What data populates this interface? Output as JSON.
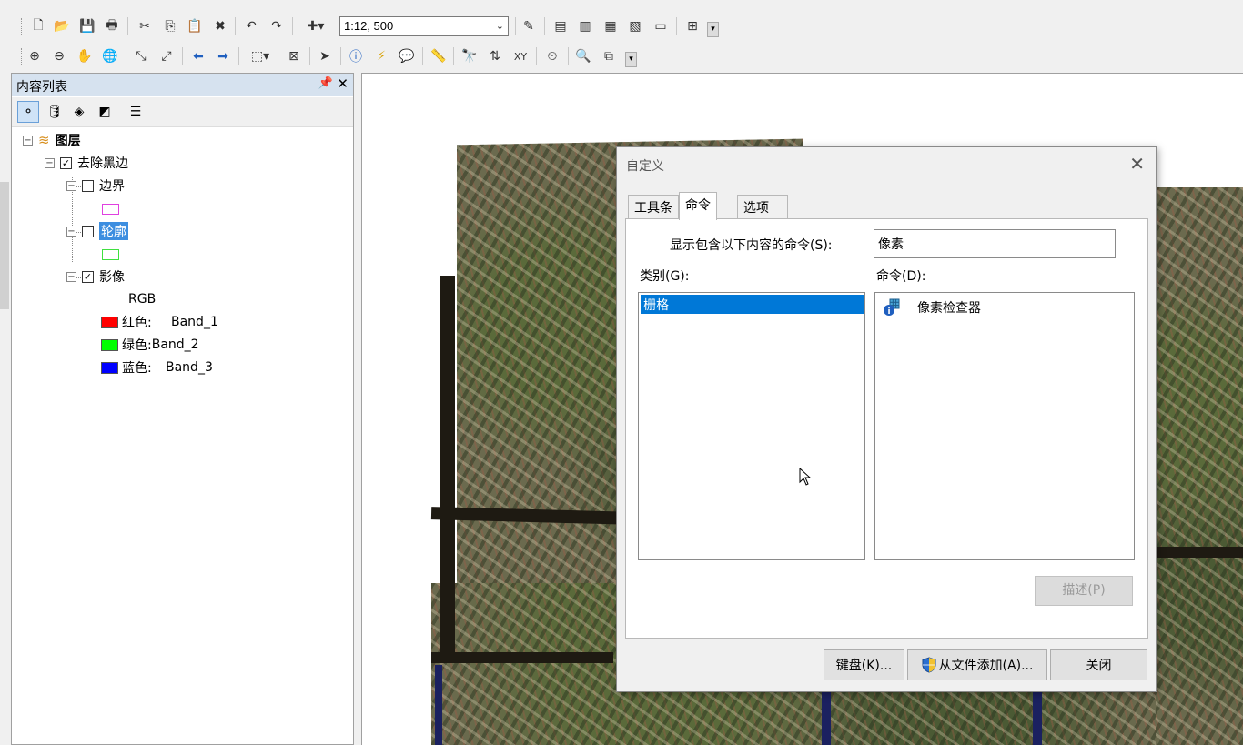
{
  "toolbar": {
    "scale_value": "1:12, 500"
  },
  "toc": {
    "title": "内容列表",
    "pin_icon": "pin-icon",
    "close_glyph": "✕",
    "tree": {
      "root_label": "图层",
      "group_label": "去除黑边",
      "layers": [
        {
          "label": "边界",
          "checked": false,
          "swatch_color": "#e040e0"
        },
        {
          "label": "轮廓",
          "checked": false,
          "selected": true,
          "swatch_color": "#40e040"
        },
        {
          "label": "影像",
          "checked": true
        }
      ],
      "raster_label": "RGB",
      "bands": [
        {
          "label": "红色:",
          "band": "Band_1",
          "color": "#ff0000"
        },
        {
          "label": "绿色:",
          "band": "Band_2",
          "color": "#00ff00"
        },
        {
          "label": "蓝色:",
          "band": "Band_3",
          "color": "#0000ff"
        }
      ]
    }
  },
  "dialog": {
    "title": "自定义",
    "tabs": [
      "工具条",
      "命令",
      "选项"
    ],
    "active_tab": "命令",
    "filter_label": "显示包含以下内容的命令(S):",
    "filter_value": "像素",
    "categories_label": "类别(G):",
    "commands_label": "命令(D):",
    "categories": [
      "栅格"
    ],
    "commands": [
      "像素检查器"
    ],
    "describe_button": "描述(P)",
    "keyboard_button": "键盘(K)...",
    "add_from_file_button": "从文件添加(A)...",
    "close_button": "关闭"
  },
  "colors": {
    "selection": "#0078d7",
    "toc_header": "#d6e2ef"
  }
}
